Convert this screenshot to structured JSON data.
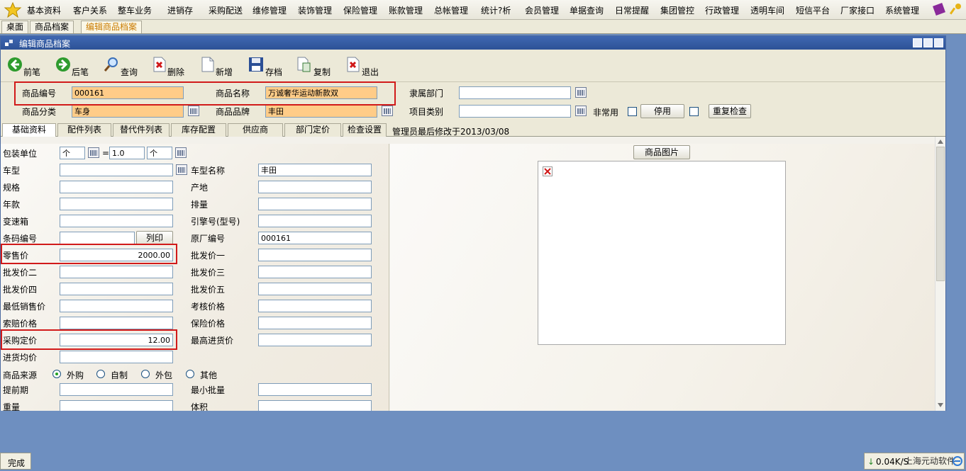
{
  "menu": [
    "基本资料",
    "客户关系",
    "整车业务",
    "进销存",
    "采购配送",
    "维修管理",
    "装饰管理",
    "保险管理",
    "账款管理",
    "总帐管理",
    "统计?析",
    "会员管理",
    "单据查询",
    "日常提醒",
    "集团管控",
    "行政管理",
    "透明车间",
    "短信平台",
    "厂家接口",
    "系统管理"
  ],
  "tabs": [
    "桌面",
    "商品档案",
    "编辑商品档案"
  ],
  "window_title": "编辑商品档案",
  "toolbar": [
    "前笔",
    "后笔",
    "查询",
    "删除",
    "新增",
    "存档",
    "复制",
    "退出"
  ],
  "head": {
    "code_label": "商品编号",
    "code_value": "000161",
    "name_label": "商品名称",
    "name_value": "万诚奢华运动新款双",
    "dept_label": "隶属部门",
    "dept_value": "",
    "cat_label": "商品分类",
    "cat_value": "车身",
    "brand_label": "商品品牌",
    "brand_value": "丰田",
    "proj_label": "项目类别",
    "proj_value": "",
    "rare_label": "非常用",
    "disable_btn": "停用",
    "recheck_btn": "重复检查"
  },
  "subtabs": [
    "基础资料",
    "配件列表",
    "替代件列表",
    "库存配置",
    "供应商",
    "部门定价",
    "检查设置"
  ],
  "modified_note": "管理员最后修改于2013/03/08",
  "left": {
    "unit_label": "包装单位",
    "unit1": "个",
    "eq": "=",
    "ratio": "1.0",
    "unit2": "个",
    "car_label": "车型",
    "car_value": "",
    "carname_label": "车型名称",
    "carname_value": "丰田",
    "spec_label": "规格",
    "spec_value": "",
    "origin_label": "产地",
    "origin_value": "",
    "year_label": "年款",
    "year_value": "",
    "disp_label": "排量",
    "disp_value": "",
    "gear_label": "变速箱",
    "gear_value": "",
    "engine_label": "引擎号(型号)",
    "engine_value": "",
    "barcode_label": "条码编号",
    "barcode_value": "",
    "print_btn": "列印",
    "oem_label": "原厂编号",
    "oem_value": "000161",
    "retail_label": "零售价",
    "retail_value": "2000.00",
    "ws1_label": "批发价一",
    "ws1_value": "",
    "ws2_label": "批发价二",
    "ws2_value": "",
    "ws3_label": "批发价三",
    "ws3_value": "",
    "ws4_label": "批发价四",
    "ws4_value": "",
    "ws5_label": "批发价五",
    "ws5_value": "",
    "minsale_label": "最低销售价",
    "minsale_value": "",
    "assess_label": "考核价格",
    "assess_value": "",
    "claim_label": "索赔价格",
    "claim_value": "",
    "insure_label": "保险价格",
    "insure_value": "",
    "purchase_label": "采购定价",
    "purchase_value": "12.00",
    "maxin_label": "最高进货价",
    "maxin_value": "",
    "avgin_label": "进货均价",
    "avgin_value": "",
    "source_label": "商品来源",
    "source_opts": [
      "外购",
      "自制",
      "外包",
      "其他"
    ],
    "lead_label": "提前期",
    "lead_value": "",
    "minbatch_label": "最小批量",
    "minbatch_value": "",
    "weight_label": "重量",
    "weight_value": "",
    "volume_label": "体积",
    "volume_value": ""
  },
  "right": {
    "pic_btn": "商品图片"
  },
  "status": "完成",
  "tray": {
    "speed": "0.04K/S",
    "brand": "上海元动软件"
  }
}
